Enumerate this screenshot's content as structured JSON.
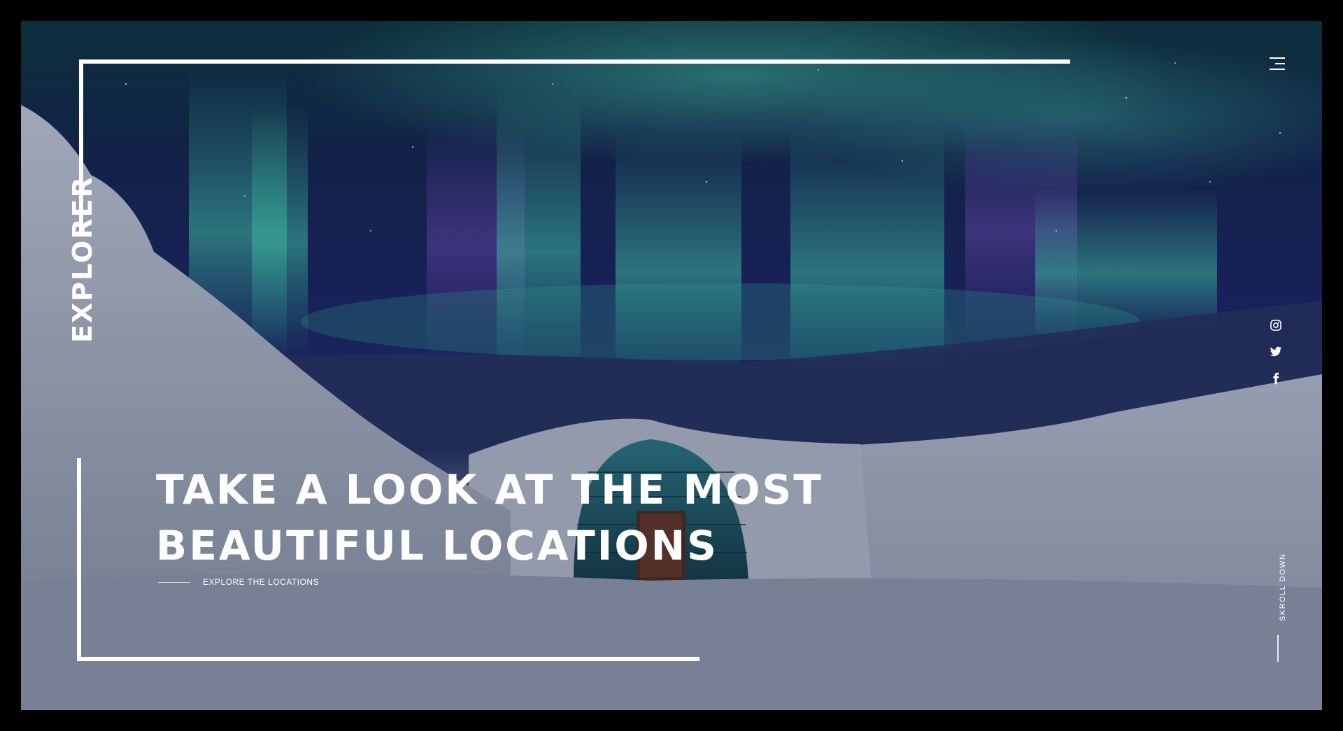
{
  "brand": {
    "logo_text": "EXPLORER"
  },
  "hero": {
    "headline_line1": "TAKE A LOOK AT THE MOST",
    "headline_line2": "BEAUTIFUL LOCATIONS",
    "explore_link": "EXPLORE THE LOCATIONS",
    "scroll_label": "SKROLL DOWN"
  },
  "header": {
    "menu_icon": "hamburger-icon"
  },
  "social": [
    {
      "icon": "instagram-icon"
    },
    {
      "icon": "twitter-icon"
    },
    {
      "icon": "facebook-icon"
    }
  ],
  "colors": {
    "frame": "#ffffff",
    "background": "#000000",
    "text": "#ffffff"
  }
}
